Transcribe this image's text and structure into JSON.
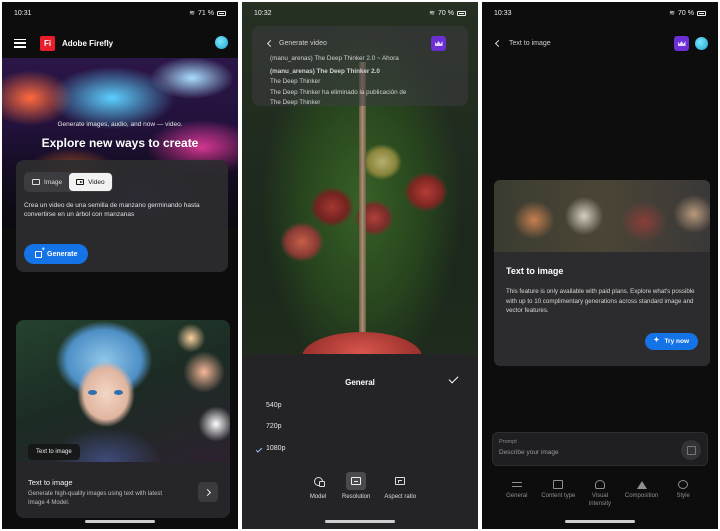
{
  "panel1": {
    "status": {
      "time": "10:31",
      "battery": "71 %"
    },
    "app": {
      "logo": "Fi",
      "name": "Adobe Firefly"
    },
    "hero": {
      "subtitle": "Generate images, audio, and now — video.",
      "title": "Explore new ways to create"
    },
    "mode_tabs": [
      {
        "label": "Image",
        "icon": "image-icon",
        "active": false
      },
      {
        "label": "Video",
        "icon": "video-icon",
        "active": true
      }
    ],
    "prompt_text": "Crea un video de una semilla de manzano germinando hasta convertirse en un árbol con manzanas",
    "generate_label": "Generate",
    "feature_card": {
      "chip": "Text to image",
      "title": "Text to image",
      "description": "Generate high-quality images using text with latest Image 4 Model."
    }
  },
  "panel2": {
    "status": {
      "time": "10:32",
      "battery": "70 %"
    },
    "notification": {
      "header": "Generate video",
      "line1": "(manu_arenas) The Deep Thinker 2.0 ~ Ahora",
      "line2": "(manu_arenas) The Deep Thinker 2.0",
      "line3": "The Deep Thinker",
      "line4": "The Deep Thinker ha eliminado la publicación de",
      "line5": "The Deep Thinker"
    },
    "sheet": {
      "title": "General",
      "options": [
        {
          "label": "540p",
          "selected": false
        },
        {
          "label": "720p",
          "selected": false
        },
        {
          "label": "1080p",
          "selected": true
        }
      ],
      "tools": [
        {
          "label": "Model",
          "icon": "model-icon",
          "selected": false
        },
        {
          "label": "Resolution",
          "icon": "resolution-icon",
          "selected": true
        },
        {
          "label": "Aspect ratio",
          "icon": "aspect-ratio-icon",
          "selected": false
        }
      ]
    }
  },
  "panel3": {
    "status": {
      "time": "10:33",
      "battery": "70 %"
    },
    "back_label": "Text to image",
    "dialog": {
      "title": "Text to image",
      "body": "This feature is only available with paid plans. Explore what's possible with up to 10 complimentary generations across standard image and vector features.",
      "button": "Try now"
    },
    "prompt": {
      "label": "Prompt",
      "placeholder": "Describe your image"
    },
    "tabs": [
      {
        "label": "General",
        "icon": "sliders-icon"
      },
      {
        "label": "Content type",
        "icon": "content-type-icon"
      },
      {
        "label": "Visual intensity",
        "icon": "visual-intensity-icon"
      },
      {
        "label": "Composition",
        "icon": "composition-icon"
      },
      {
        "label": "Style",
        "icon": "style-icon"
      }
    ]
  },
  "colors": {
    "accent": "#1473e6",
    "premium": "#6b2fd4",
    "logo": "#ea1e2a"
  }
}
